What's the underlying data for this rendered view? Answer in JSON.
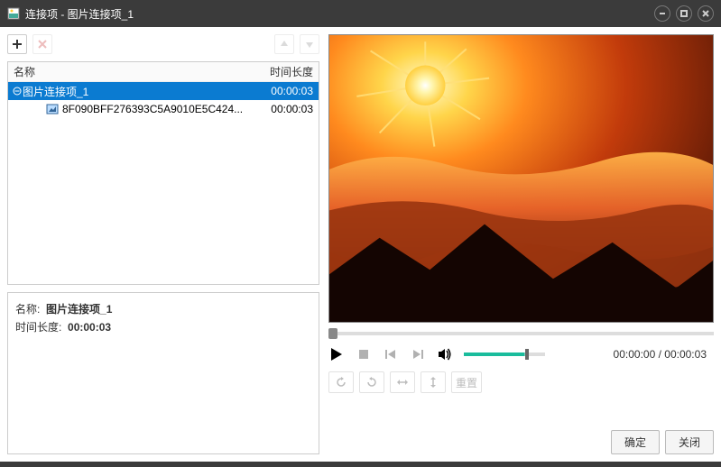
{
  "window": {
    "title": "连接项 - 图片连接项_1"
  },
  "list": {
    "header_name": "名称",
    "header_duration": "时间长度",
    "parent": {
      "name": "图片连接项_1",
      "duration": "00:00:03"
    },
    "child": {
      "name": "8F090BFF276393C5A9010E5C424...",
      "duration": "00:00:03"
    }
  },
  "info": {
    "name_label": "名称:",
    "name_value": "图片连接项_1",
    "dur_label": "时间长度:",
    "dur_value": "00:00:03"
  },
  "player": {
    "current": "00:00:00",
    "total": "00:00:03",
    "sep": " / "
  },
  "tools": {
    "reset": "重置"
  },
  "footer": {
    "ok": "确定",
    "close": "关闭"
  }
}
